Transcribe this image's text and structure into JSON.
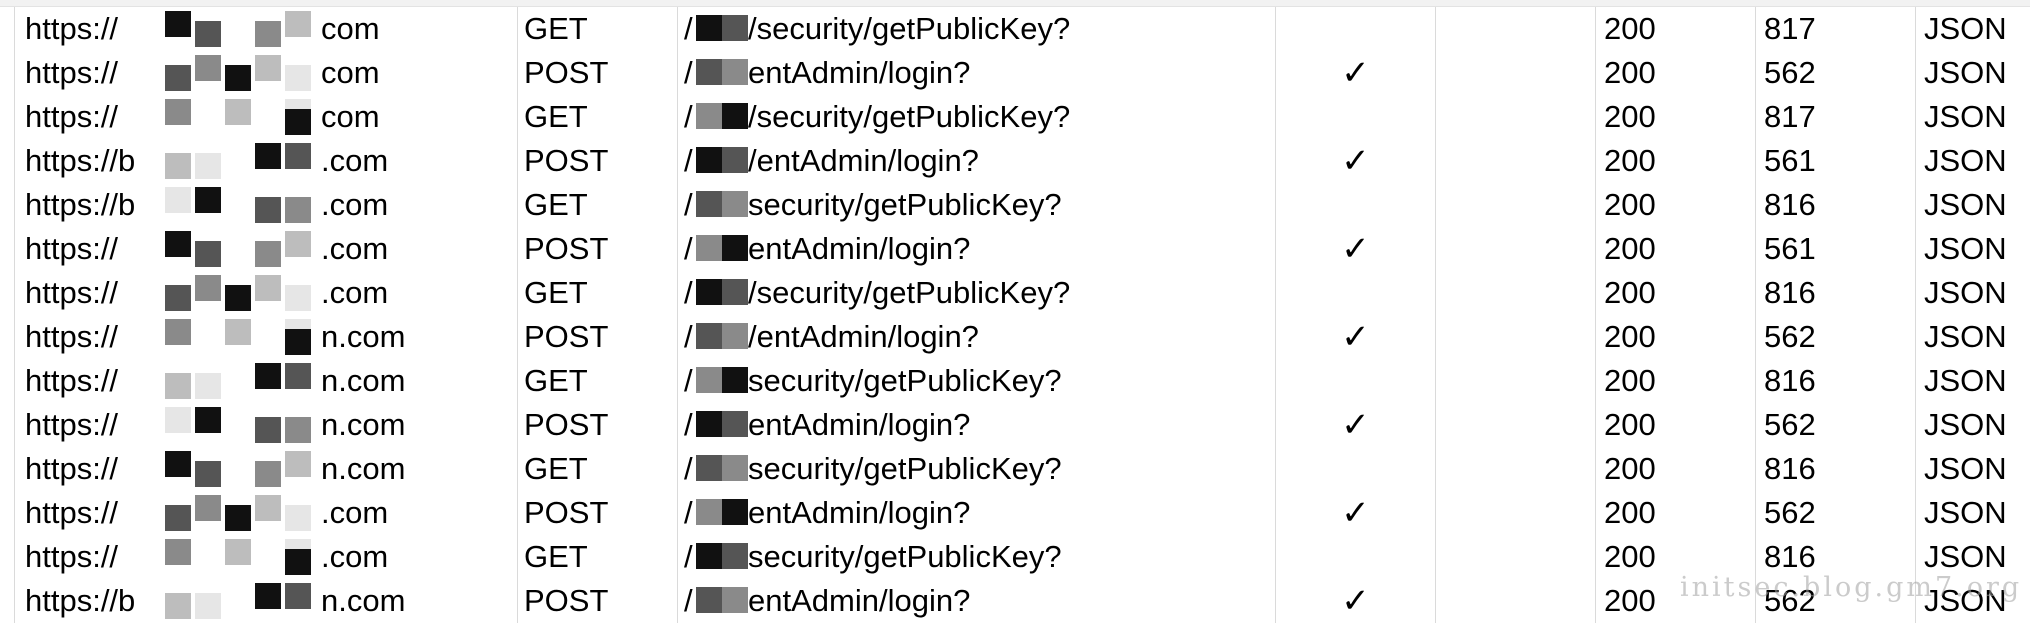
{
  "rows": [
    {
      "host_prefix": "https://",
      "host_suffix": "com",
      "method": "GET",
      "path_prefix": "/",
      "path": "/security/getPublicKey?",
      "encrypted": "",
      "status": "200",
      "size": "817",
      "type": "JSON"
    },
    {
      "host_prefix": "https://",
      "host_suffix": "com",
      "method": "POST",
      "path_prefix": "/",
      "path": "entAdmin/login?",
      "encrypted": "✓",
      "status": "200",
      "size": "562",
      "type": "JSON"
    },
    {
      "host_prefix": "https://",
      "host_suffix": "com",
      "method": "GET",
      "path_prefix": "/",
      "path": "/security/getPublicKey?",
      "encrypted": "",
      "status": "200",
      "size": "817",
      "type": "JSON"
    },
    {
      "host_prefix": "https://b",
      "host_suffix": ".com",
      "method": "POST",
      "path_prefix": "/",
      "path": "/entAdmin/login?",
      "encrypted": "✓",
      "status": "200",
      "size": "561",
      "type": "JSON"
    },
    {
      "host_prefix": "https://b",
      "host_suffix": ".com",
      "method": "GET",
      "path_prefix": "/",
      "path": "security/getPublicKey?",
      "encrypted": "",
      "status": "200",
      "size": "816",
      "type": "JSON"
    },
    {
      "host_prefix": "https://",
      "host_suffix": ".com",
      "method": "POST",
      "path_prefix": "/",
      "path": "entAdmin/login?",
      "encrypted": "✓",
      "status": "200",
      "size": "561",
      "type": "JSON"
    },
    {
      "host_prefix": "https://",
      "host_suffix": ".com",
      "method": "GET",
      "path_prefix": "/",
      "path": "/security/getPublicKey?",
      "encrypted": "",
      "status": "200",
      "size": "816",
      "type": "JSON"
    },
    {
      "host_prefix": "https://",
      "host_suffix": "n.com",
      "method": "POST",
      "path_prefix": "/",
      "path": "/entAdmin/login?",
      "encrypted": "✓",
      "status": "200",
      "size": "562",
      "type": "JSON"
    },
    {
      "host_prefix": "https://",
      "host_suffix": "n.com",
      "method": "GET",
      "path_prefix": "/",
      "path": "security/getPublicKey?",
      "encrypted": "",
      "status": "200",
      "size": "816",
      "type": "JSON"
    },
    {
      "host_prefix": "https://",
      "host_suffix": "n.com",
      "method": "POST",
      "path_prefix": "/",
      "path": "entAdmin/login?",
      "encrypted": "✓",
      "status": "200",
      "size": "562",
      "type": "JSON"
    },
    {
      "host_prefix": "https://",
      "host_suffix": "n.com",
      "method": "GET",
      "path_prefix": "/",
      "path": "security/getPublicKey?",
      "encrypted": "",
      "status": "200",
      "size": "816",
      "type": "JSON"
    },
    {
      "host_prefix": "https://",
      "host_suffix": ".com",
      "method": "POST",
      "path_prefix": "/",
      "path": "entAdmin/login?",
      "encrypted": "✓",
      "status": "200",
      "size": "562",
      "type": "JSON"
    },
    {
      "host_prefix": "https://",
      "host_suffix": ".com",
      "method": "GET",
      "path_prefix": "/",
      "path": "security/getPublicKey?",
      "encrypted": "",
      "status": "200",
      "size": "816",
      "type": "JSON"
    },
    {
      "host_prefix": "https://b",
      "host_suffix": "n.com",
      "method": "POST",
      "path_prefix": "/",
      "path": "entAdmin/login?",
      "encrypted": "✓",
      "status": "200",
      "size": "562",
      "type": "JSON"
    }
  ],
  "watermark": "initsec.blog.gm7.org",
  "redaction_colors": [
    "#111111",
    "#555555",
    "#8a8a8a",
    "#bdbdbd",
    "#e6e6e6"
  ]
}
